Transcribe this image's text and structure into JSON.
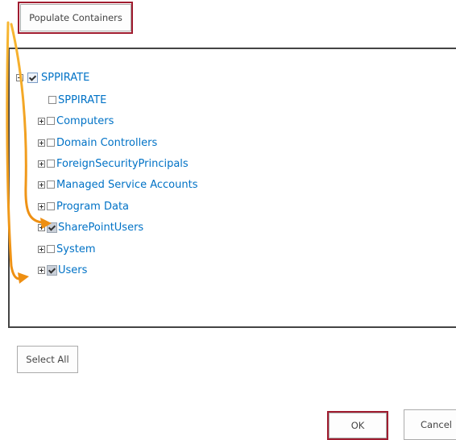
{
  "buttons": {
    "populate": "Populate Containers",
    "select_all": "Select All",
    "ok": "OK",
    "cancel": "Cancel"
  },
  "tree": {
    "root": {
      "label": "SPPIRATE",
      "checked": true,
      "expanded": true
    },
    "children": [
      {
        "label": "SPPIRATE",
        "checked": false,
        "expandable": false
      },
      {
        "label": "Computers",
        "checked": false,
        "expandable": true
      },
      {
        "label": "Domain Controllers",
        "checked": false,
        "expandable": true
      },
      {
        "label": "ForeignSecurityPrincipals",
        "checked": false,
        "expandable": true
      },
      {
        "label": "Managed Service Accounts",
        "checked": false,
        "expandable": true
      },
      {
        "label": "Program Data",
        "checked": false,
        "expandable": true
      },
      {
        "label": "SharePointUsers",
        "checked": true,
        "expandable": true
      },
      {
        "label": "System",
        "checked": false,
        "expandable": true
      },
      {
        "label": "Users",
        "checked": true,
        "expandable": true
      }
    ]
  },
  "annotations": {
    "highlight_color": "#a01c2f",
    "arrow_color": "#f0a21e"
  }
}
